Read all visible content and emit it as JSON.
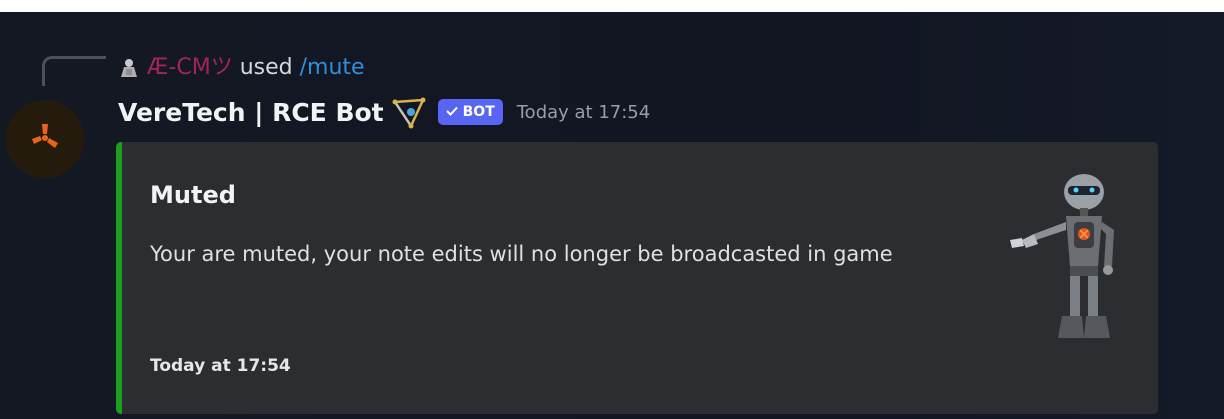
{
  "reply": {
    "user": "Æ-CMツ",
    "text": "used",
    "command": "/mute"
  },
  "message": {
    "username": "VereTech | RCE Bot",
    "badge": "BOT",
    "timestamp": "Today at 17:54"
  },
  "embed": {
    "title": "Muted",
    "description": "Your are muted, your note edits will no longer be broadcasted in game",
    "footer": "Today at 17:54",
    "accent_color": "#1ea01e"
  },
  "colors": {
    "badge": "#5865f2",
    "command": "#2f8fd8",
    "reply_user": "#a4245a"
  },
  "icons": [
    "reply-user-icon",
    "avatar-rust-icon",
    "username-emoji-icon",
    "checkmark-icon",
    "robot-thumbnail"
  ]
}
